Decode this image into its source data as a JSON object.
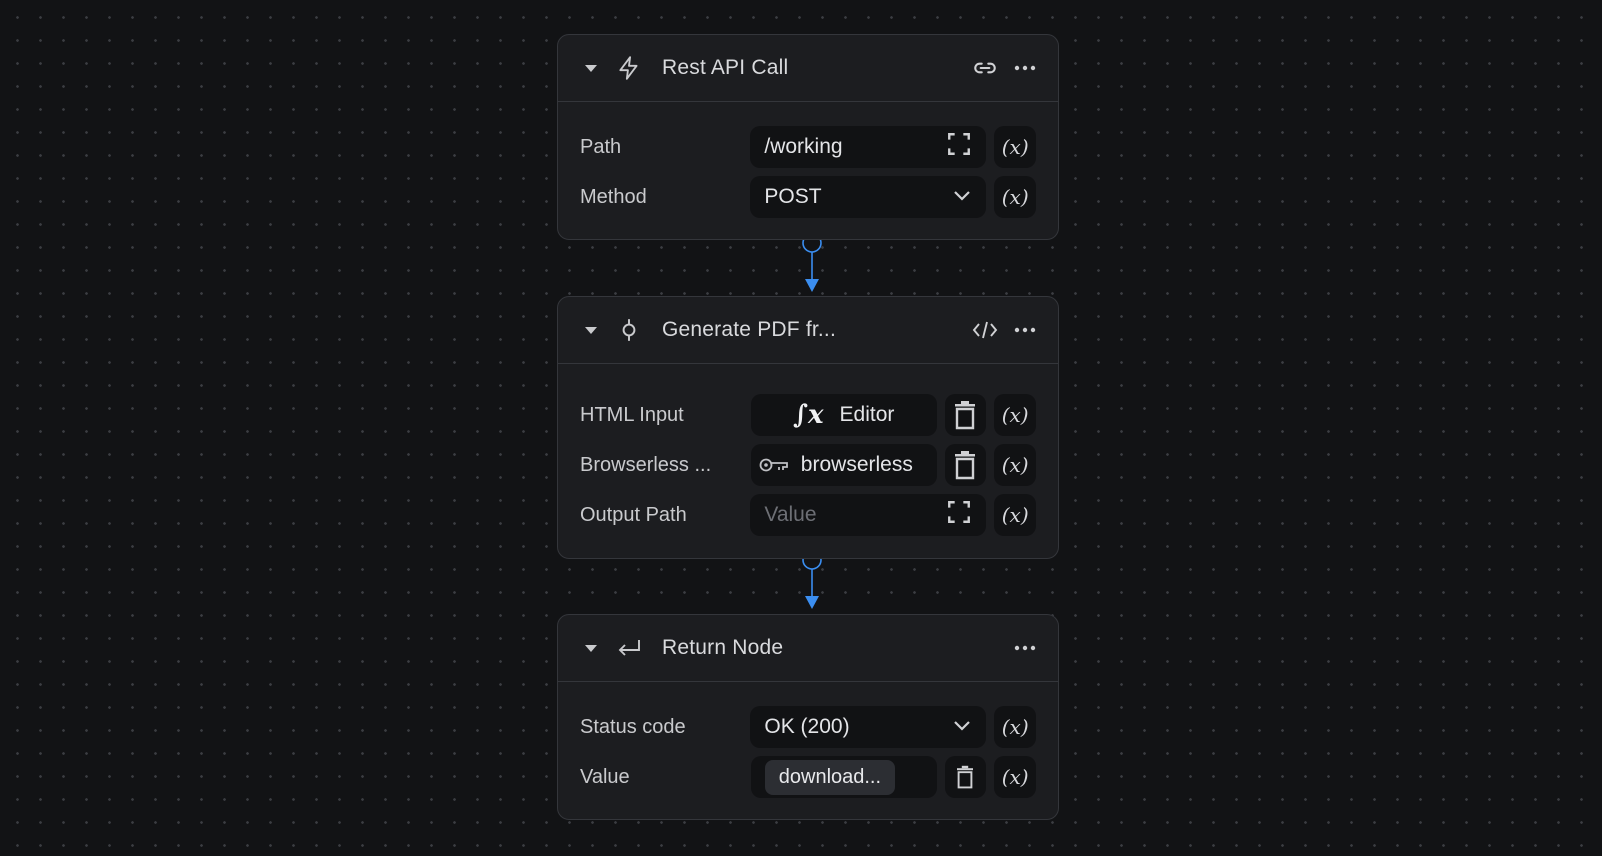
{
  "nodes": {
    "rest": {
      "title": "Rest API Call",
      "fields": [
        {
          "label": "Path",
          "value": "/working"
        },
        {
          "label": "Method",
          "value": "POST"
        }
      ]
    },
    "pdf": {
      "title": "Generate PDF fr...",
      "fields": [
        {
          "label": "HTML Input",
          "value": "Editor"
        },
        {
          "label": "Browserless ...",
          "value": "browserless"
        },
        {
          "label": "Output Path",
          "placeholder": "Value"
        }
      ]
    },
    "ret": {
      "title": "Return Node",
      "fields": [
        {
          "label": "Status code",
          "value": "OK (200)"
        },
        {
          "label": "Value",
          "value": "download..."
        }
      ]
    }
  },
  "variable_button_label": "(x)",
  "colors": {
    "background": "#121315",
    "node": "#1c1d20",
    "accent": "#3b8ef0"
  }
}
